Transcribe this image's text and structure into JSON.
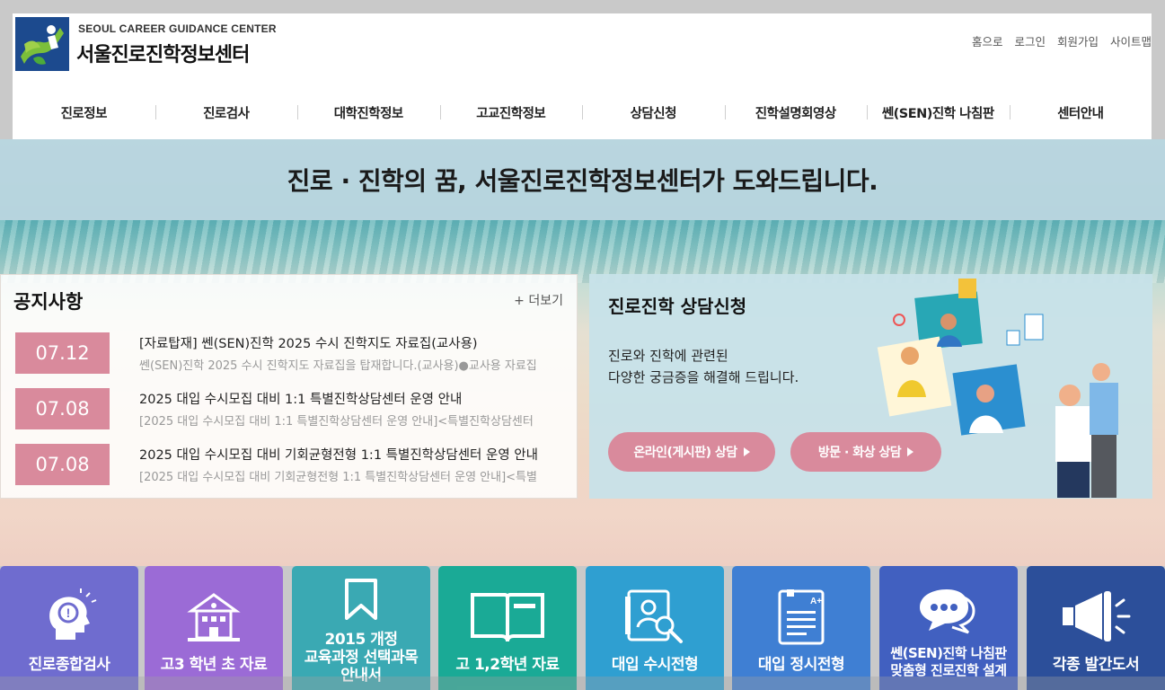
{
  "header": {
    "logo_en": "SEOUL CAREER GUIDANCE CENTER",
    "logo_ko": "서울진로진학정보센터",
    "util_links": [
      "홈으로",
      "로그인",
      "회원가입",
      "사이트맵"
    ]
  },
  "gnb": [
    "진로정보",
    "진로검사",
    "대학진학정보",
    "고교진학정보",
    "상담신청",
    "진학설명회영상",
    "쎈(SEN)진학 나침판",
    "센터안내"
  ],
  "hero": {
    "slogan": "진로 · 진학의 꿈, 서울진로진학정보센터가 도와드립니다."
  },
  "notice": {
    "title": "공지사항",
    "more": "+ 더보기",
    "items": [
      {
        "date": "07.12",
        "title": "[자료탑재] 쎈(SEN)진학 2025 수시 진학지도 자료집(교사용)",
        "summary": "쎈(SEN)진학 2025 수시 진학지도 자료집을 탑재합니다.(교사용)●교사용 자료집"
      },
      {
        "date": "07.08",
        "title": "2025 대입 수시모집 대비 1:1 특별진학상담센터 운영 안내",
        "summary": "[2025 대입 수시모집 대비 1:1 특별진학상담센터 운영 안내]<특별진학상담센터"
      },
      {
        "date": "07.08",
        "title": "2025 대입 수시모집 대비 기회균형전형 1:1 특별진학상담센터 운영 안내",
        "summary": "[2025 대입 수시모집 대비 기회균형전형 1:1 특별진학상담센터 운영 안내]<특별"
      }
    ]
  },
  "counsel": {
    "title": "진로진학 상담신청",
    "desc": [
      "진로와 진학에 관련된",
      "다양한 궁금증을 해결해 드립니다."
    ],
    "online_btn": "온라인(게시판) 상담",
    "visit_btn": "방문 · 화상 상담"
  },
  "quick": [
    {
      "lines": [
        "진로종합검사"
      ],
      "color": "#6f6ccf",
      "icon": "head-thinking-icon"
    },
    {
      "lines": [
        "고3 학년 초 자료"
      ],
      "color": "#9b6bd6",
      "icon": "school-icon"
    },
    {
      "lines": [
        "2015 개정",
        "교육과정 선택과목",
        "안내서"
      ],
      "color": "#3aa9b3",
      "icon": "bookmark-icon"
    },
    {
      "lines": [
        "고 1,2학년 자료"
      ],
      "color": "#1aaa96",
      "icon": "open-book-icon"
    },
    {
      "lines": [
        "대입 수시전형"
      ],
      "color": "#2f9fd1",
      "icon": "profile-search-icon"
    },
    {
      "lines": [
        "대입 정시전형"
      ],
      "color": "#3f7fd3",
      "icon": "grade-report-icon"
    },
    {
      "lines": [
        "쎈(SEN)진학 나침판",
        "맞춤형 진로진학 설계"
      ],
      "color": "#4160c0",
      "icon": "chat-bubble-icon"
    },
    {
      "lines": [
        "각종 발간도서"
      ],
      "color": "#2c4f9a",
      "icon": "megaphone-icon"
    }
  ]
}
